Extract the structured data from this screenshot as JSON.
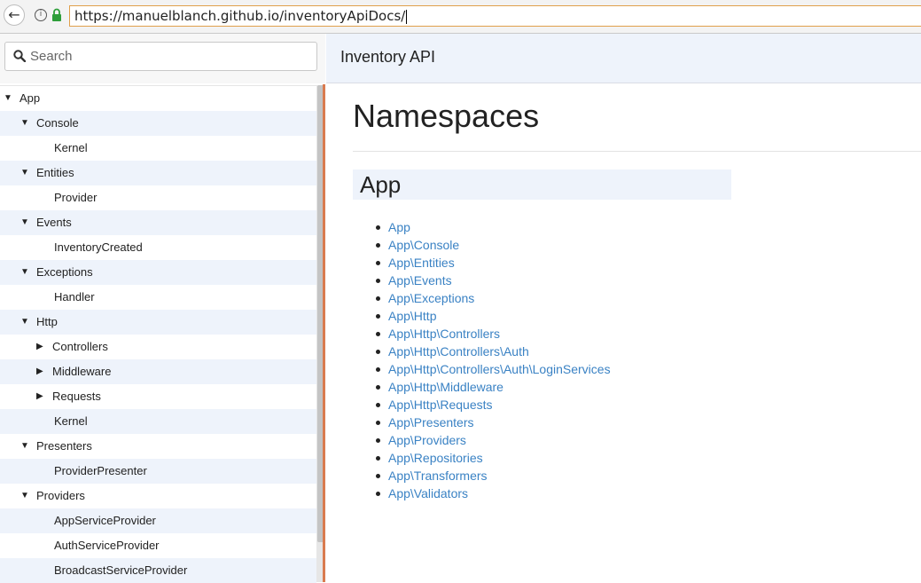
{
  "browser": {
    "url": "https://manuelblanch.github.io/inventoryApiDocs/",
    "back_glyph": "←",
    "info_glyph": "i"
  },
  "search": {
    "placeholder": "Search",
    "value": ""
  },
  "tree": [
    {
      "label": "App",
      "level": 0,
      "toggle": "expanded"
    },
    {
      "label": "Console",
      "level": 1,
      "toggle": "expanded"
    },
    {
      "label": "Kernel",
      "level": 2,
      "toggle": "none"
    },
    {
      "label": "Entities",
      "level": 1,
      "toggle": "expanded"
    },
    {
      "label": "Provider",
      "level": 2,
      "toggle": "none"
    },
    {
      "label": "Events",
      "level": 1,
      "toggle": "expanded"
    },
    {
      "label": "InventoryCreated",
      "level": 2,
      "toggle": "none"
    },
    {
      "label": "Exceptions",
      "level": 1,
      "toggle": "expanded"
    },
    {
      "label": "Handler",
      "level": 2,
      "toggle": "none"
    },
    {
      "label": "Http",
      "level": 1,
      "toggle": "expanded"
    },
    {
      "label": "Controllers",
      "level": 2,
      "toggle": "collapsed"
    },
    {
      "label": "Middleware",
      "level": 2,
      "toggle": "collapsed"
    },
    {
      "label": "Requests",
      "level": 2,
      "toggle": "collapsed"
    },
    {
      "label": "Kernel",
      "level": 2,
      "toggle": "none"
    },
    {
      "label": "Presenters",
      "level": 1,
      "toggle": "expanded"
    },
    {
      "label": "ProviderPresenter",
      "level": 2,
      "toggle": "none"
    },
    {
      "label": "Providers",
      "level": 1,
      "toggle": "expanded"
    },
    {
      "label": "AppServiceProvider",
      "level": 2,
      "toggle": "none"
    },
    {
      "label": "AuthServiceProvider",
      "level": 2,
      "toggle": "none"
    },
    {
      "label": "BroadcastServiceProvider",
      "level": 2,
      "toggle": "none"
    }
  ],
  "header": {
    "title": "Inventory API"
  },
  "main": {
    "title": "Namespaces",
    "section_heading": "App",
    "namespaces": [
      "App",
      "App\\Console",
      "App\\Entities",
      "App\\Events",
      "App\\Exceptions",
      "App\\Http",
      "App\\Http\\Controllers",
      "App\\Http\\Controllers\\Auth",
      "App\\Http\\Controllers\\Auth\\LoginServices",
      "App\\Http\\Middleware",
      "App\\Http\\Requests",
      "App\\Presenters",
      "App\\Providers",
      "App\\Repositories",
      "App\\Transformers",
      "App\\Validators"
    ]
  },
  "colors": {
    "link": "#3a82c4",
    "header_bg": "#eef3fb",
    "divider": "#d97b4f",
    "url_border": "#e0a04b"
  },
  "icons": [
    "back-arrow-icon",
    "info-icon",
    "lock-icon",
    "search-icon",
    "triangle-down-icon",
    "triangle-right-icon"
  ]
}
